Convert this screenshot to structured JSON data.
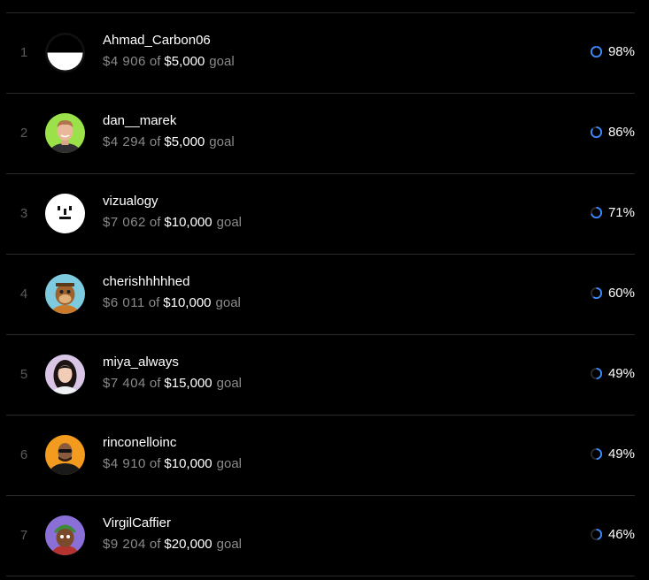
{
  "colors": {
    "background": "#000000",
    "ring_progress": "#3b8bff",
    "ring_track": "#2b2b2b",
    "muted_text": "#8a8a8a",
    "rank_text": "#5a5a5a"
  },
  "labels": {
    "of": "of",
    "goal": "goal"
  },
  "rows": [
    {
      "rank": "1",
      "username": "Ahmad_Carbon06",
      "raised": "$4 906",
      "goal": "$5,000",
      "percent_label": "98%",
      "percent": 98,
      "avatar": "half-black-white-circle-avatar"
    },
    {
      "rank": "2",
      "username": "dan__marek",
      "raised": "$4 294",
      "goal": "$5,000",
      "percent_label": "86%",
      "percent": 86,
      "avatar": "smiling-man-green-background-avatar"
    },
    {
      "rank": "3",
      "username": "vizualogy",
      "raised": "$7 062",
      "goal": "$10,000",
      "percent_label": "71%",
      "percent": 71,
      "avatar": "pixel-face-avatar"
    },
    {
      "rank": "4",
      "username": "cherishhhhhed",
      "raised": "$6 011",
      "goal": "$10,000",
      "percent_label": "60%",
      "percent": 60,
      "avatar": "cartoon-ape-avatar"
    },
    {
      "rank": "5",
      "username": "miya_always",
      "raised": "$7 404",
      "goal": "$15,000",
      "percent_label": "49%",
      "percent": 49,
      "avatar": "woman-portrait-avatar"
    },
    {
      "rank": "6",
      "username": "rinconelloinc",
      "raised": "$4 910",
      "goal": "$10,000",
      "percent_label": "49%",
      "percent": 49,
      "avatar": "man-sunglasses-orange-background-avatar"
    },
    {
      "rank": "7",
      "username": "VirgilCaffier",
      "raised": "$9 204",
      "goal": "$20,000",
      "percent_label": "46%",
      "percent": 46,
      "avatar": "cartoon-character-purple-background-avatar"
    }
  ]
}
